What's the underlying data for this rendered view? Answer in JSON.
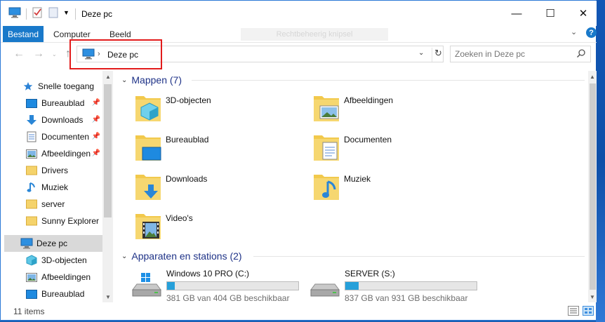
{
  "window": {
    "title": "Deze pc",
    "controls": {
      "minimize": "—",
      "maximize": "☐",
      "close": "✕"
    }
  },
  "ribbon": {
    "tabs": [
      "Bestand",
      "Computer",
      "Beeld"
    ],
    "contextual_tab": "Rechtbeheerig knipsel",
    "help": "?"
  },
  "navigation": {
    "back": "←",
    "forward": "→",
    "up": "↑",
    "address": {
      "location": "Deze pc",
      "separator": "›"
    },
    "search": {
      "placeholder": "Zoeken in Deze pc"
    }
  },
  "sidebar": {
    "quick_access": "Snelle toegang",
    "items": [
      {
        "label": "Bureaublad",
        "icon": "desktop-icon",
        "pinned": true
      },
      {
        "label": "Downloads",
        "icon": "download-icon",
        "pinned": true
      },
      {
        "label": "Documenten",
        "icon": "documents-icon",
        "pinned": true
      },
      {
        "label": "Afbeeldingen",
        "icon": "pictures-icon",
        "pinned": true
      },
      {
        "label": "Drivers",
        "icon": "folder-icon",
        "pinned": false
      },
      {
        "label": "Muziek",
        "icon": "music-icon",
        "pinned": false
      },
      {
        "label": "server",
        "icon": "folder-icon",
        "pinned": false
      },
      {
        "label": "Sunny Explorer",
        "icon": "folder-icon",
        "pinned": false
      }
    ],
    "this_pc": "Deze pc",
    "this_pc_items": [
      {
        "label": "3D-objecten",
        "icon": "3d-objects-icon"
      },
      {
        "label": "Afbeeldingen",
        "icon": "pictures-icon"
      },
      {
        "label": "Bureaublad",
        "icon": "desktop-icon"
      }
    ]
  },
  "content": {
    "folders_header": "Mappen (7)",
    "folders": [
      {
        "label": "3D-objecten",
        "icon": "3d-objects-icon"
      },
      {
        "label": "Afbeeldingen",
        "icon": "pictures-icon"
      },
      {
        "label": "Bureaublad",
        "icon": "desktop-icon"
      },
      {
        "label": "Documenten",
        "icon": "documents-icon"
      },
      {
        "label": "Downloads",
        "icon": "download-icon"
      },
      {
        "label": "Muziek",
        "icon": "music-icon"
      },
      {
        "label": "Video's",
        "icon": "video-icon"
      }
    ],
    "devices_header": "Apparaten en stations (2)",
    "drives": [
      {
        "label": "Windows 10 PRO (C:)",
        "free": "381 GB van 404 GB beschikbaar",
        "used_fraction": 0.06,
        "icon": "windows-drive-icon"
      },
      {
        "label": "SERVER (S:)",
        "free": "837 GB van 931 GB beschikbaar",
        "used_fraction": 0.1,
        "icon": "drive-icon"
      }
    ]
  },
  "status": {
    "items": "11 items"
  },
  "colors": {
    "accent": "#1979ca",
    "folder": "#f2c94c",
    "highlight": "#e21b1b",
    "drive_bar": "#26a0da"
  }
}
